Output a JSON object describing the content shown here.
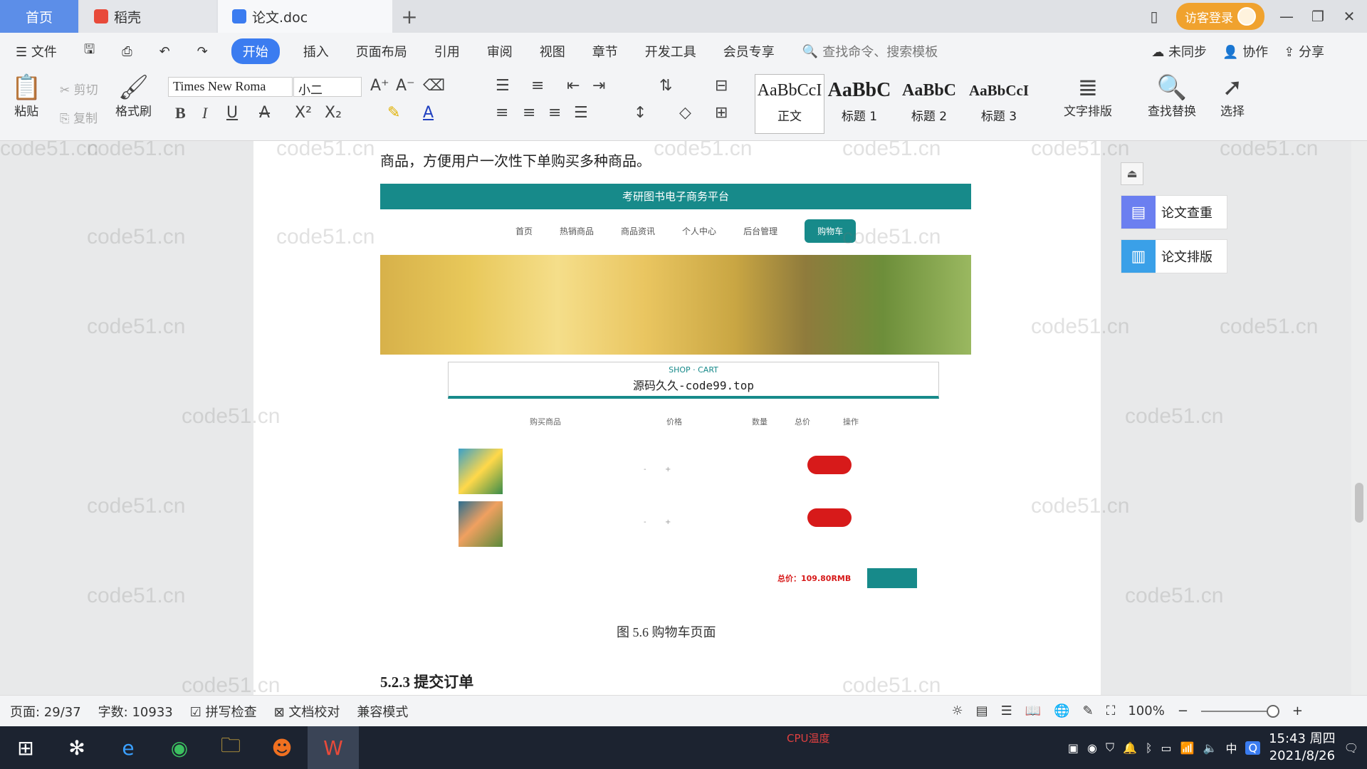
{
  "tabs": [
    {
      "label": "首页"
    },
    {
      "label": "稻壳"
    },
    {
      "label": "论文.doc"
    }
  ],
  "titlebar": {
    "login": "访客登录"
  },
  "menu": {
    "items": [
      "文件",
      "开始",
      "插入",
      "页面布局",
      "引用",
      "审阅",
      "视图",
      "章节",
      "开发工具",
      "会员专享"
    ],
    "search": "查找命令、搜索模板",
    "right": [
      "未同步",
      "协作",
      "分享"
    ]
  },
  "ribbon": {
    "paste": "粘贴",
    "cut": "剪切",
    "copy": "复制",
    "format_painter": "格式刷",
    "font": "Times New Roma",
    "size": "小二",
    "styles": [
      {
        "preview": "AaBbCcI",
        "name": "正文"
      },
      {
        "preview": "AaBbC",
        "name": "标题 1"
      },
      {
        "preview": "AaBbC",
        "name": "标题 2"
      },
      {
        "preview": "AaBbCcI",
        "name": "标题 3"
      }
    ],
    "text_layout": "文字排版",
    "find_replace": "查找替换",
    "select": "选择"
  },
  "document": {
    "body_text": "商品，方便用户一次性下单购买多种商品。",
    "screenshot": {
      "site_title": "考研图书电子商务平台",
      "nav": [
        "首页",
        "热销商品",
        "商品资讯",
        "个人中心",
        "后台管理",
        "购物车"
      ],
      "shop_cart": "SHOP · CART",
      "overlay": "源码久久-code99.top",
      "headers": [
        "购买商品",
        "价格",
        "数量",
        "总价",
        "操作"
      ],
      "total": "总价：109.80RMB"
    },
    "caption": "图 5.6  购物车页面",
    "heading": "5.2.3  提交订单"
  },
  "watermark": "code51.cn",
  "side": {
    "check": "论文查重",
    "format": "论文排版"
  },
  "status": {
    "page": "页面: 29/37",
    "words": "字数: 10933",
    "spell": "拼写检查",
    "proof": "文档校对",
    "compat": "兼容模式",
    "zoom": "100%"
  },
  "taskbar": {
    "time": "15:43 周四",
    "date": "2021/8/26",
    "ime": "中",
    "cpu": "CPU温度"
  },
  "colors": {
    "accent": "#3b7cf0",
    "teal": "#178a8a",
    "login": "#f0a22e",
    "danger": "#d71a1a"
  }
}
